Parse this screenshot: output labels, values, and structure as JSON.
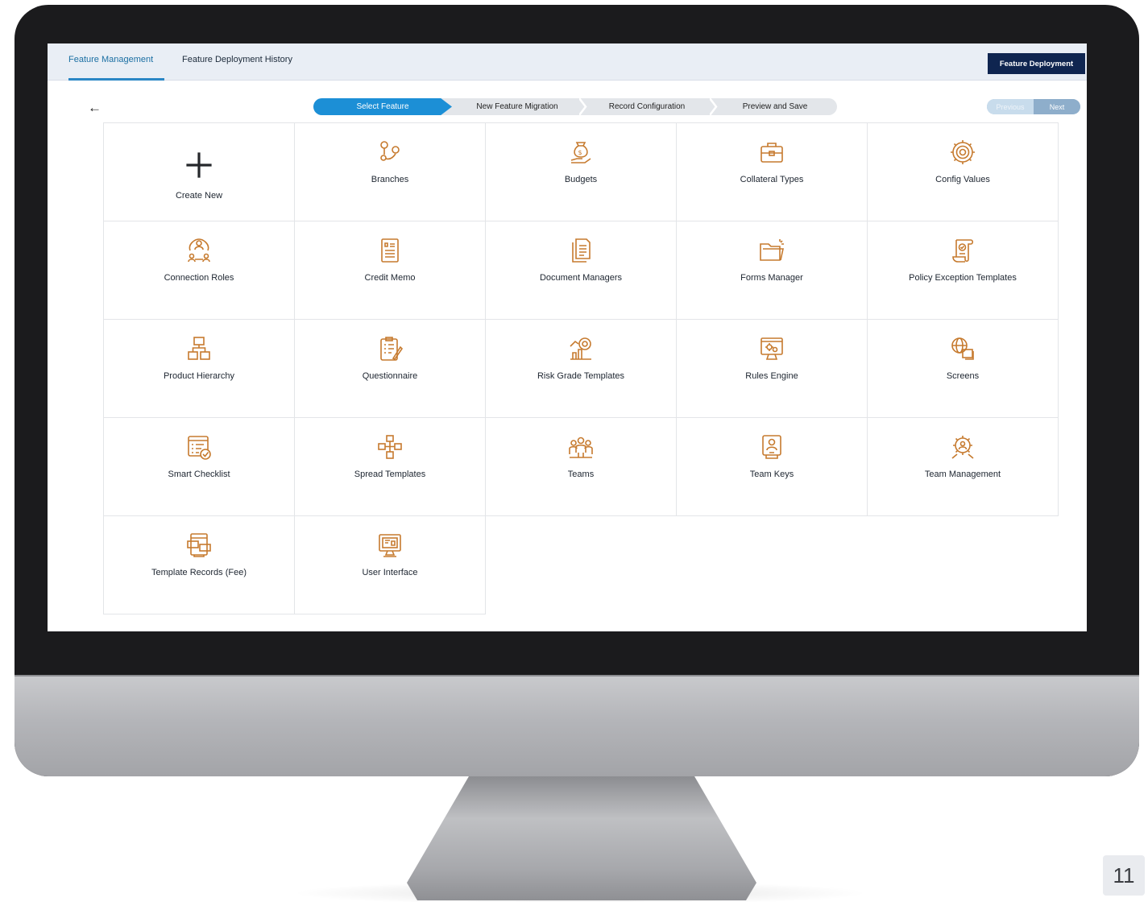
{
  "tabs": [
    {
      "label": "Feature Management",
      "active": true
    },
    {
      "label": "Feature Deployment History",
      "active": false
    }
  ],
  "header": {
    "deploy_button": "Feature Deployment"
  },
  "stepper": {
    "steps": [
      "Select Feature",
      "New Feature Migration",
      "Record Configuration",
      "Preview and Save"
    ],
    "active_index": 0
  },
  "pager": {
    "previous": "Previous",
    "next": "Next"
  },
  "features": [
    {
      "label": "Create New",
      "icon": "plus-icon"
    },
    {
      "label": "Branches",
      "icon": "branches-icon"
    },
    {
      "label": "Budgets",
      "icon": "money-bag-icon"
    },
    {
      "label": "Collateral Types",
      "icon": "briefcase-icon"
    },
    {
      "label": "Config Values",
      "icon": "gear-icon"
    },
    {
      "label": "Connection Roles",
      "icon": "connection-roles-icon"
    },
    {
      "label": "Credit Memo",
      "icon": "memo-icon"
    },
    {
      "label": "Document Managers",
      "icon": "documents-icon"
    },
    {
      "label": "Forms Manager",
      "icon": "folder-icon"
    },
    {
      "label": "Policy Exception Templates",
      "icon": "policy-scroll-icon"
    },
    {
      "label": "Product Hierarchy",
      "icon": "hierarchy-icon"
    },
    {
      "label": "Questionnaire",
      "icon": "clipboard-icon"
    },
    {
      "label": "Risk Grade Templates",
      "icon": "risk-chart-icon"
    },
    {
      "label": "Rules Engine",
      "icon": "rules-monitor-icon"
    },
    {
      "label": "Screens",
      "icon": "globe-screens-icon"
    },
    {
      "label": "Smart Checklist",
      "icon": "checklist-icon"
    },
    {
      "label": "Spread Templates",
      "icon": "spread-icon"
    },
    {
      "label": "Teams",
      "icon": "team-icon"
    },
    {
      "label": "Team Keys",
      "icon": "team-key-icon"
    },
    {
      "label": "Team Management",
      "icon": "team-management-icon"
    },
    {
      "label": "Template Records (Fee)",
      "icon": "template-records-icon"
    },
    {
      "label": "User Interface",
      "icon": "monitor-icon"
    }
  ],
  "page_number": "11",
  "colors": {
    "accent": "#1c8fd6",
    "icon": "#c67a2e",
    "deploy_button": "#0f2550"
  }
}
